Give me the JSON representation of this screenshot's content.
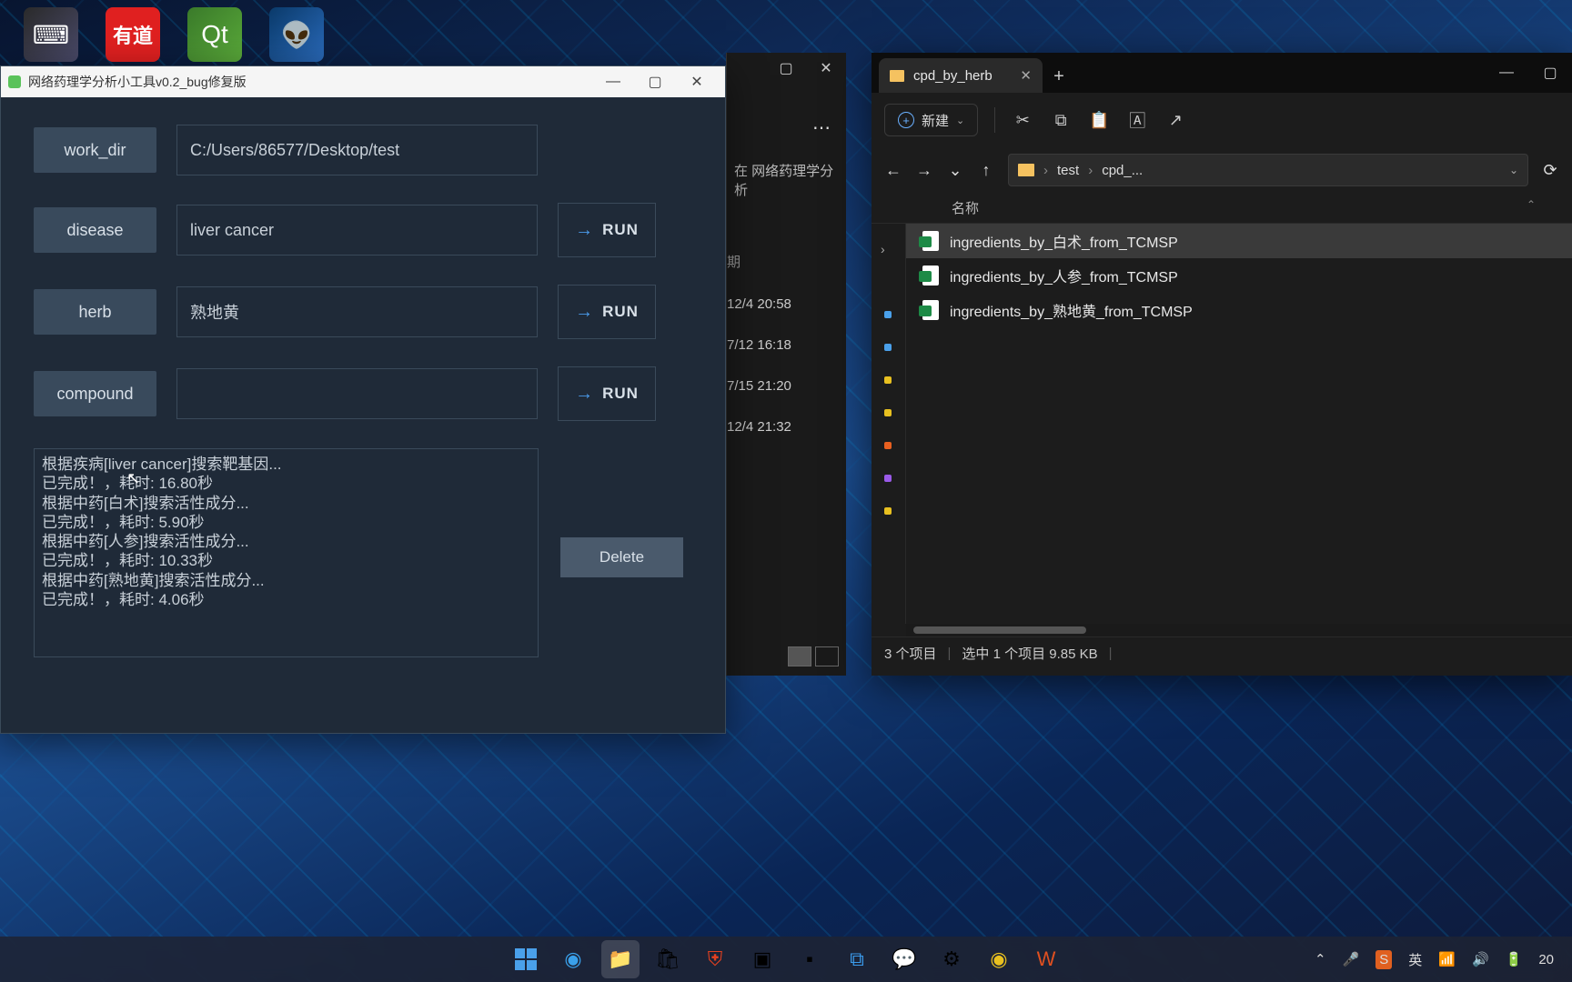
{
  "desktop": {
    "icons": [
      "⌨",
      "有道",
      "Qt",
      "👽"
    ]
  },
  "app": {
    "title": "网络药理学分析小工具v0.2_bug修复版",
    "rows": [
      {
        "label": "work_dir",
        "value": "C:/Users/86577/Desktop/test",
        "run": false
      },
      {
        "label": "disease",
        "value": "liver cancer",
        "run": true
      },
      {
        "label": "herb",
        "value": "熟地黄",
        "run": true
      },
      {
        "label": "compound",
        "value": "",
        "run": true
      }
    ],
    "run_label": "RUN",
    "delete_label": "Delete",
    "log": "根据疾病[liver cancer]搜索靶基因...\n已完成！，耗时: 16.80秒\n根据中药[白术]搜索活性成分...\n已完成！，耗时: 5.90秒\n根据中药[人参]搜索活性成分...\n已完成！，耗时: 10.33秒\n根据中药[熟地黄]搜索活性成分...\n已完成！，耗时: 4.06秒"
  },
  "explorer_bg": {
    "crumb": "在 网络药理学分析",
    "date_header": "期",
    "dates": [
      "12/4 20:58",
      "7/12 16:18",
      "7/15 21:20",
      "12/4 21:32"
    ]
  },
  "explorer2": {
    "tab": "cpd_by_herb",
    "new_label": "新建",
    "breadcrumb": [
      "test",
      "cpd_..."
    ],
    "col_name": "名称",
    "files": [
      {
        "name": "ingredients_by_白术_from_TCMSP",
        "selected": true
      },
      {
        "name": "ingredients_by_人参_from_TCMSP",
        "selected": false
      },
      {
        "name": "ingredients_by_熟地黄_from_TCMSP",
        "selected": false
      }
    ],
    "status_count": "3 个项目",
    "status_sel": "选中 1 个项目  9.85 KB"
  },
  "taskbar": {
    "tray_text": "20"
  }
}
